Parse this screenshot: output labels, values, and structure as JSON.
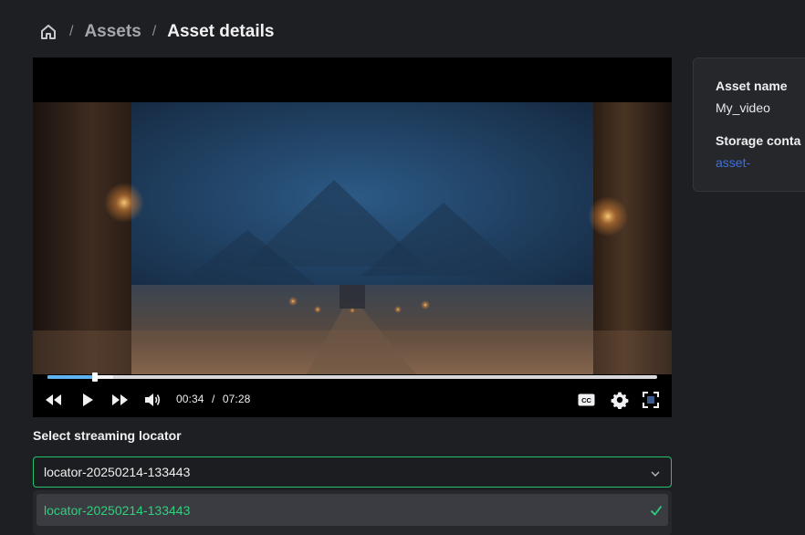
{
  "breadcrumb": {
    "home_icon": "home-icon",
    "separator": "/",
    "items": [
      "Assets",
      "Asset details"
    ]
  },
  "player": {
    "current_time": "00:34",
    "time_separator": "/",
    "duration": "07:28",
    "progress_fraction": 0.078,
    "buffered_fraction": 0.108,
    "icons": [
      "rewind-icon",
      "play-icon",
      "fast-forward-icon",
      "volume-icon",
      "captions-icon",
      "settings-icon",
      "fullscreen-icon"
    ],
    "accent": "#5fb3f0"
  },
  "info": {
    "asset_name_label": "Asset name",
    "asset_name_value": "My_video",
    "storage_label": "Storage conta",
    "storage_value": "asset-"
  },
  "locator": {
    "label": "Select streaming locator",
    "selected": "locator-20250214-133443",
    "options": [
      "locator-20250214-133443"
    ],
    "accent": "#25c26e"
  }
}
